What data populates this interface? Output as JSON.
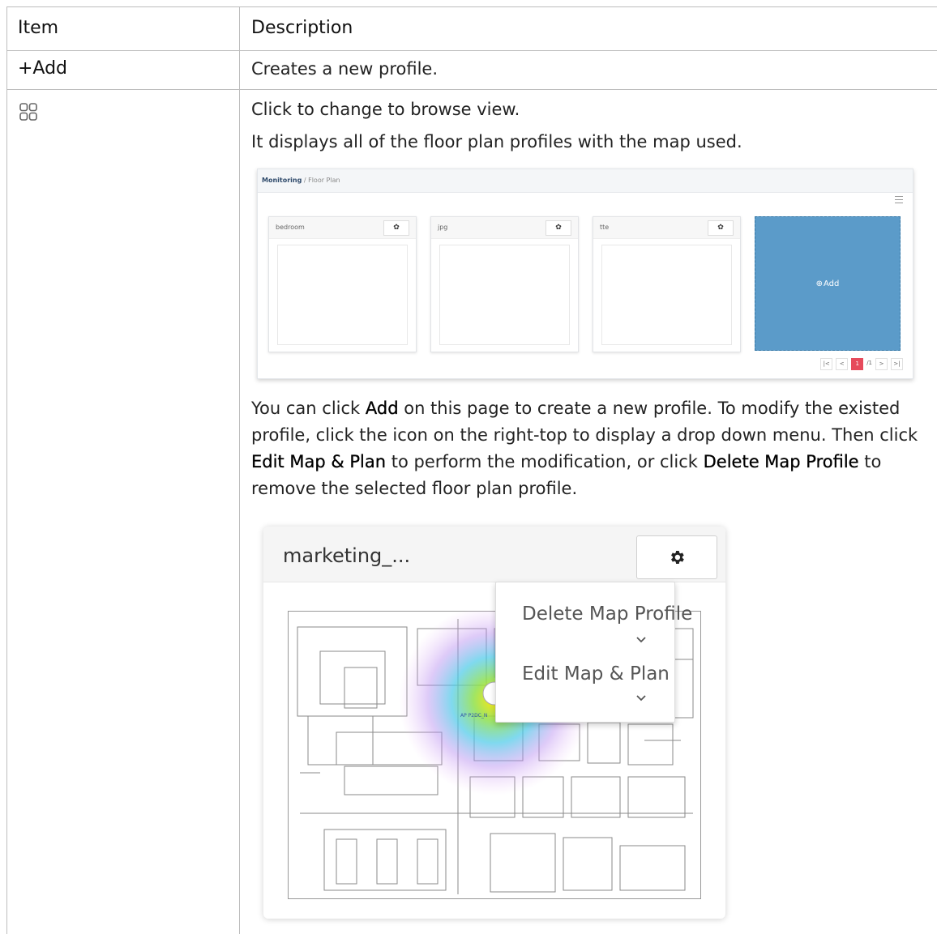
{
  "table": {
    "header": {
      "item": "Item",
      "description": "Description"
    },
    "rows": [
      {
        "item": "+Add",
        "description": "Creates a new profile."
      },
      {
        "item_icon": "grid-view-icon",
        "lines": [
          "Click to change to browse view.",
          "It displays all of the floor plan profiles with the map used."
        ],
        "para": {
          "p1": "You can click ",
          "b1": "Add",
          "p2": " on this page to create a new profile. To modify the existed profile, click the icon on the right-top to display a drop down menu. Then click ",
          "b2": "Edit Map & Plan",
          "p3": " to perform the modification, or click ",
          "b3": "Delete Map Profile",
          "p4": " to remove the selected floor plan profile."
        }
      }
    ]
  },
  "browse_view": {
    "breadcrumb_strong": "Monitoring",
    "breadcrumb_rest": " / Floor Plan",
    "cards": [
      "bedroom",
      "jpg",
      "tte"
    ],
    "add_label": "Add",
    "pager": {
      "first": "|<",
      "prev": "<",
      "current": "1",
      "total": "/1",
      "next": ">",
      "last": ">|"
    }
  },
  "profile_card": {
    "title": "marketing_...",
    "menu": [
      "Delete Map Profile",
      "Edit Map & Plan"
    ],
    "ap_label": "AP P2DC_N"
  }
}
